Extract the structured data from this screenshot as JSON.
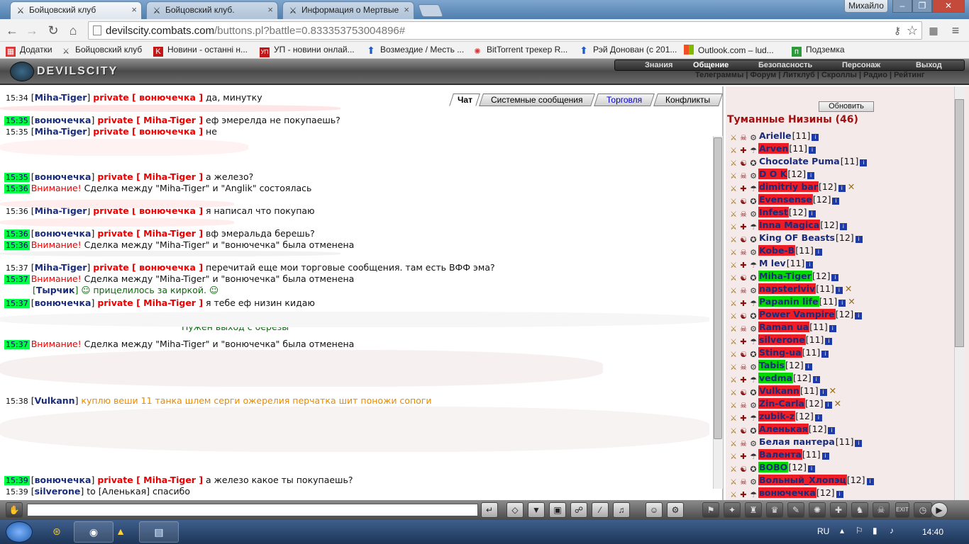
{
  "browser": {
    "tabs": [
      {
        "title": "Бойцовский клуб"
      },
      {
        "title": "Бойцовский клуб."
      },
      {
        "title": "Информация о Мертвые"
      }
    ],
    "window_user": "Михайло",
    "url_host": "devilscity.combats.com",
    "url_rest": "/buttons.pl?battle=0.833353753004896#",
    "bookmarks": [
      "Додатки",
      "Бойцовский клуб",
      "Новини - останні н...",
      "УП - новини онлай...",
      "Возмездие / Месть ...",
      "BitTorrent трекер R...",
      "Рэй Донован (с 201...",
      "Outlook.com – lud...",
      "Подземка"
    ]
  },
  "game": {
    "logo": "DEVILSCITY",
    "top_menu": [
      "Знания",
      "Общение",
      "Безопасность",
      "Персонаж",
      "Выход"
    ],
    "sub_menu": "Телеграммы | Форум | Литклуб | Скроллы | Радио | Рейтинг"
  },
  "chat": {
    "tabs": [
      "Чат",
      "Системные сообщения",
      "Торговля",
      "Конфликты"
    ],
    "lines": [
      {
        "time": "15:34",
        "green": false,
        "nick": "Miha-Tiger",
        "priv": "private [ вонючечка ]",
        "text": "да, минутку"
      },
      {
        "time": "15:35",
        "green": true,
        "nick": "вонючечка",
        "priv": "private [ Miha-Tiger ]",
        "text": "еф эмерелда не покупаешь?"
      },
      {
        "time": "15:35",
        "green": false,
        "nick": "Miha-Tiger",
        "priv": "private [ вонючечка ]",
        "text": "не"
      },
      {
        "time": "15:35",
        "green": true,
        "nick": "вонючечка",
        "priv": "private [ Miha-Tiger ]",
        "text": "а железо?"
      },
      {
        "time": "15:36",
        "green": true,
        "warn": "Внимание!",
        "text": "Сделка между \"Miha-Tiger\" и \"Anglik\" состоялась"
      },
      {
        "time": "15:36",
        "green": false,
        "nick": "Miha-Tiger",
        "priv": "private [ вонючечка ]",
        "text": "я написал что покупаю"
      },
      {
        "time": "15:36",
        "green": true,
        "nick": "вонючечка",
        "priv": "private [ Miha-Tiger ]",
        "text": "вф эмеральда берешь?"
      },
      {
        "time": "15:36",
        "green": true,
        "warn": "Внимание!",
        "text": "Сделка между \"Miha-Tiger\" и \"вонючечка\" была отменена"
      },
      {
        "time": "15:37",
        "green": false,
        "nick": "Miha-Tiger",
        "priv": "private [ вонючечка ]",
        "text": "перечитай еще мои торговые сообщения. там есть ВФФ эма?"
      },
      {
        "time": "15:37",
        "green": true,
        "warn": "Внимание!",
        "text": "Сделка между \"Miha-Tiger\" и \"вонючечка\" была отменена"
      },
      {
        "time": "",
        "green": false,
        "nick": "Тырчик",
        "priv": "",
        "text": "прицелилось за киркой."
      },
      {
        "time": "15:37",
        "green": true,
        "nick": "вонючечка",
        "priv": "private [ Miha-Tiger ]",
        "text": "я тебе еф низин кидаю"
      },
      {
        "time": "",
        "green": false,
        "nick": "",
        "priv": "",
        "text": "Нужен выход с березы"
      },
      {
        "time": "15:37",
        "green": true,
        "warn": "Внимание!",
        "text": "Сделка между \"Miha-Tiger\" и \"вонючечка\" была отменена"
      },
      {
        "time": "15:38",
        "green": false,
        "nick": "Vulkann",
        "priv": "",
        "orange": "куплю веши 11 танка шлем серги ожерелия перчатка шит поножи сопоги",
        "text": ""
      },
      {
        "time": "15:39",
        "green": true,
        "nick": "вонючечка",
        "priv": "private [ Miha-Tiger ]",
        "text": "а железо какое ты покупаешь?"
      },
      {
        "time": "15:39",
        "green": false,
        "nick": "silverone",
        "priv": "",
        "text": "to [Аленькая] спасибо"
      }
    ]
  },
  "room": {
    "refresh": "Обновить",
    "title": "Туманные Низины (46)",
    "players": [
      {
        "name": "Arielle",
        "level": "[11]",
        "style": "plain",
        "x": false
      },
      {
        "name": "Arven",
        "level": "[11]",
        "style": "red",
        "x": false
      },
      {
        "name": "Chocolate Puma",
        "level": "[11]",
        "style": "plain",
        "x": false
      },
      {
        "name": "D O K",
        "level": "[12]",
        "style": "red",
        "x": false
      },
      {
        "name": "dimitriy bar",
        "level": "[12]",
        "style": "red",
        "x": true
      },
      {
        "name": "Evensense",
        "level": "[12]",
        "style": "red",
        "x": false
      },
      {
        "name": "Infest",
        "level": "[12]",
        "style": "red",
        "x": false
      },
      {
        "name": "Inna Magica",
        "level": "[12]",
        "style": "red",
        "x": false
      },
      {
        "name": "King OF Beasts",
        "level": "[12]",
        "style": "plain",
        "x": false
      },
      {
        "name": "Kobe-B",
        "level": "[11]",
        "style": "red",
        "x": false
      },
      {
        "name": "M lev",
        "level": "[11]",
        "style": "plain",
        "x": false
      },
      {
        "name": "Miha-Tiger",
        "level": "[12]",
        "style": "green",
        "x": false
      },
      {
        "name": "napsterlviv",
        "level": "[11]",
        "style": "red",
        "x": true
      },
      {
        "name": "Papanin life",
        "level": "[11]",
        "style": "green",
        "x": true
      },
      {
        "name": "Power Vampire",
        "level": "[12]",
        "style": "red",
        "x": false
      },
      {
        "name": "Raman ua",
        "level": "[11]",
        "style": "red",
        "x": false
      },
      {
        "name": "silverone",
        "level": "[11]",
        "style": "red",
        "x": false
      },
      {
        "name": "Sting-ua",
        "level": "[11]",
        "style": "red",
        "x": false
      },
      {
        "name": "Tabis",
        "level": "[12]",
        "style": "green",
        "x": false
      },
      {
        "name": "vedma",
        "level": "[12]",
        "style": "green",
        "x": false
      },
      {
        "name": "Vulkann",
        "level": "[11]",
        "style": "red",
        "x": true
      },
      {
        "name": "Zin-Carla",
        "level": "[12]",
        "style": "red",
        "x": true
      },
      {
        "name": "zubik-z",
        "level": "[12]",
        "style": "red",
        "x": false
      },
      {
        "name": "Аленькая",
        "level": "[12]",
        "style": "red",
        "x": false
      },
      {
        "name": "Белая пантера",
        "level": "[11]",
        "style": "plain",
        "x": false
      },
      {
        "name": "Валента",
        "level": "[11]",
        "style": "red",
        "x": false
      },
      {
        "name": "BOBO",
        "level": "[12]",
        "style": "green",
        "x": false
      },
      {
        "name": "Вольный_Хлопэц",
        "level": "[12]",
        "style": "red",
        "x": false
      },
      {
        "name": "вонючечка",
        "level": "[12]",
        "style": "red",
        "x": false
      }
    ]
  },
  "taskbar": {
    "lang": "RU",
    "clock": "14:40"
  },
  "colors": {
    "timestamp_green": "#00ff44",
    "nick_blue": "#1a2c7a",
    "private_red": "#e00000",
    "highlight_red": "#ee1c25",
    "highlight_green": "#00d800"
  }
}
